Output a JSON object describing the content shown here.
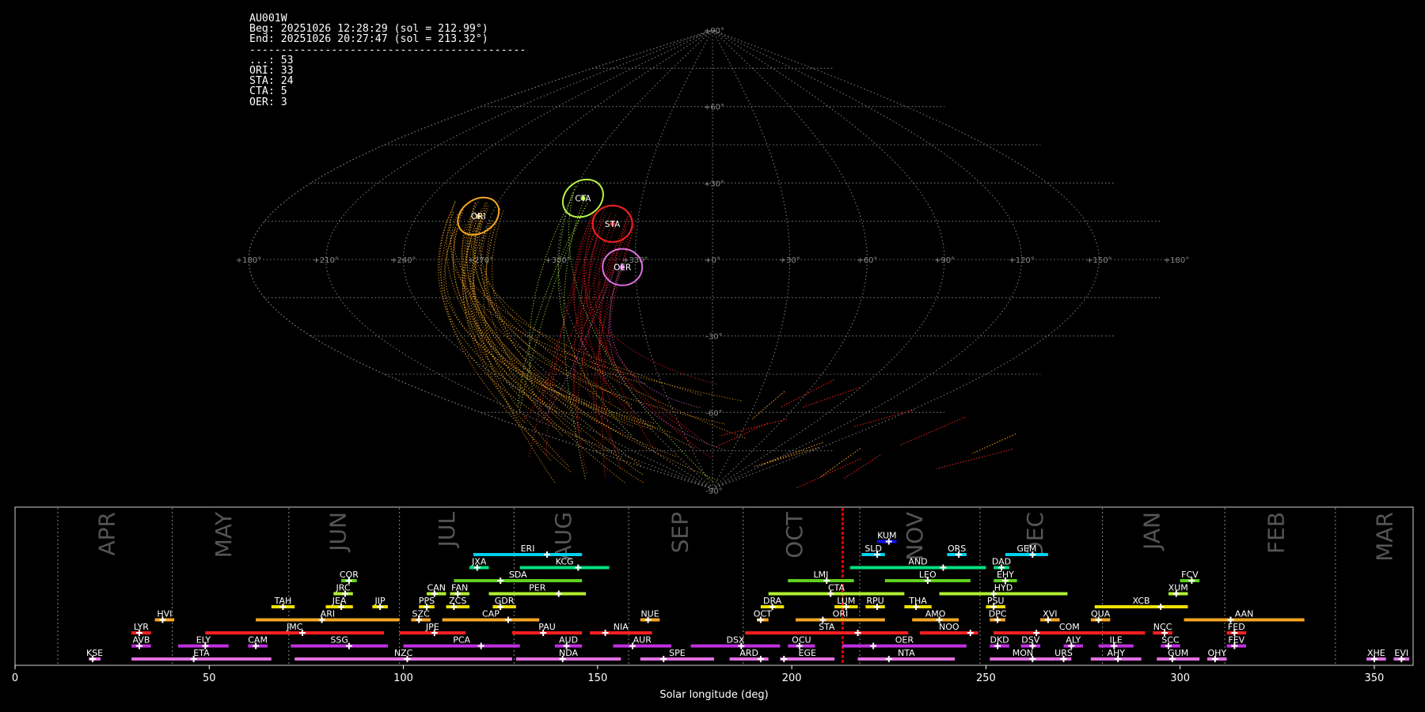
{
  "stats": {
    "station": "AU001W",
    "beg": "Beg: 20251026 12:28:29 (sol = 212.99°)",
    "end": "End: 20251026 20:27:47 (sol = 213.32°)",
    "sep": "--------------------------------------------",
    "counts": [
      "...: 53",
      "ORI: 33",
      "STA: 24",
      "CTA: 5",
      "OER: 3"
    ]
  },
  "colors": {
    "background": "#000000",
    "grid": "#777777",
    "ORI": "#f5a623",
    "STA": "#ff2020",
    "CTA": "#b7f542",
    "OER": "#e070e0",
    "sporadic": "#cc2222",
    "current_sol": "#dd0000"
  },
  "chart_data": [
    {
      "type": "scatter",
      "projection": "sinusoidal",
      "lon_labels": [
        "+180°",
        "+150°",
        "+120°",
        "+90°",
        "+60°",
        "+30°",
        "+0°",
        "+330°",
        "+300°",
        "+270°",
        "+240°",
        "+210°",
        "+180°"
      ],
      "lat_labels": [
        "+90°",
        "+60°",
        "+30°",
        "-30°",
        "-60°",
        "-90°"
      ],
      "radiants": [
        {
          "name": "ORI",
          "lon": 95,
          "lat": 17,
          "color": "#f5a623"
        },
        {
          "name": "CTA",
          "lon": 55,
          "lat": 24,
          "color": "#b7f542"
        },
        {
          "name": "STA",
          "lon": 40,
          "lat": 14,
          "color": "#ff2020"
        },
        {
          "name": "OER",
          "lon": 35,
          "lat": -3,
          "color": "#e070e0"
        }
      ],
      "radiant_counts": {
        "...": 53,
        "ORI": 33,
        "STA": 24,
        "CTA": 5,
        "OER": 3
      }
    },
    {
      "type": "timeline",
      "xlabel": "Solar longitude (deg)",
      "xlim": [
        0,
        360
      ],
      "xticks": [
        0,
        50,
        100,
        150,
        200,
        250,
        300,
        350
      ],
      "current_sol": 213.1,
      "months": [
        {
          "name": "APR",
          "start": 11,
          "label": 24
        },
        {
          "name": "MAY",
          "start": 40.5,
          "label": 54
        },
        {
          "name": "JUN",
          "start": 70.5,
          "label": 83.5
        },
        {
          "name": "JUL",
          "start": 99,
          "label": 111.5
        },
        {
          "name": "AUG",
          "start": 128.5,
          "label": 141.5
        },
        {
          "name": "SEP",
          "start": 158,
          "label": 171.5
        },
        {
          "name": "OCT",
          "start": 187.5,
          "label": 201
        },
        {
          "name": "NOV",
          "start": 217.5,
          "label": 232
        },
        {
          "name": "DEC",
          "start": 248.5,
          "label": 263
        },
        {
          "name": "JAN",
          "start": 280,
          "label": 293
        },
        {
          "name": "FEB",
          "start": 311.5,
          "label": 325
        },
        {
          "name": "MAR",
          "start": 340,
          "label": 353
        }
      ],
      "showers": [
        {
          "code": "KUM",
          "row": 9,
          "start": 222,
          "end": 227,
          "peak": 225,
          "color": "#1010ee"
        },
        {
          "code": "ERI",
          "row": 8,
          "start": 118,
          "end": 146,
          "peak": 137,
          "color": "#00d0f0"
        },
        {
          "code": "SLD",
          "row": 8,
          "start": 218,
          "end": 224,
          "peak": 222,
          "color": "#00d0f0"
        },
        {
          "code": "ORS",
          "row": 8,
          "start": 240,
          "end": 245,
          "peak": 243,
          "color": "#00d0f0"
        },
        {
          "code": "GEM",
          "row": 8,
          "start": 255,
          "end": 266,
          "peak": 262,
          "color": "#00d0f0"
        },
        {
          "code": "JXA",
          "row": 7,
          "start": 117,
          "end": 122,
          "peak": 119,
          "color": "#00e080"
        },
        {
          "code": "KCG",
          "row": 7,
          "start": 130,
          "end": 153,
          "peak": 145,
          "color": "#00e080"
        },
        {
          "code": "AND",
          "row": 7,
          "start": 215,
          "end": 250,
          "peak": 239,
          "color": "#00e080"
        },
        {
          "code": "DAD",
          "row": 7,
          "start": 252,
          "end": 256,
          "peak": 254,
          "color": "#00e080"
        },
        {
          "code": "COR",
          "row": 6,
          "start": 84,
          "end": 88,
          "peak": 86,
          "color": "#60d020"
        },
        {
          "code": "SDA",
          "row": 6,
          "start": 113,
          "end": 146,
          "peak": 125,
          "color": "#60d020"
        },
        {
          "code": "LMI",
          "row": 6,
          "start": 199,
          "end": 216,
          "peak": 209,
          "color": "#60d020"
        },
        {
          "code": "LEO",
          "row": 6,
          "start": 224,
          "end": 246,
          "peak": 235,
          "color": "#60d020"
        },
        {
          "code": "EHY",
          "row": 6,
          "start": 252,
          "end": 258,
          "peak": 255,
          "color": "#60d020"
        },
        {
          "code": "FCV",
          "row": 6,
          "start": 300,
          "end": 305,
          "peak": 303,
          "color": "#60d020"
        },
        {
          "code": "JRC",
          "row": 5,
          "start": 82,
          "end": 87,
          "peak": 85,
          "color": "#b0f030"
        },
        {
          "code": "CAN",
          "row": 5,
          "start": 106,
          "end": 111,
          "peak": 108,
          "color": "#b0f030"
        },
        {
          "code": "FAN",
          "row": 5,
          "start": 112,
          "end": 117,
          "peak": 114,
          "color": "#b0f030"
        },
        {
          "code": "PER",
          "row": 5,
          "start": 122,
          "end": 147,
          "peak": 140,
          "color": "#b0f030"
        },
        {
          "code": "CTA",
          "row": 5,
          "start": 194,
          "end": 229,
          "peak": 210,
          "color": "#b0f030"
        },
        {
          "code": "HYD",
          "row": 5,
          "start": 238,
          "end": 271,
          "peak": 252,
          "color": "#b0f030"
        },
        {
          "code": "XUM",
          "row": 5,
          "start": 297,
          "end": 302,
          "peak": 299,
          "color": "#b0f030"
        },
        {
          "code": "TAH",
          "row": 4,
          "start": 66,
          "end": 72,
          "peak": 69,
          "color": "#f0e000"
        },
        {
          "code": "JEA",
          "row": 4,
          "start": 80,
          "end": 87,
          "peak": 84,
          "color": "#f0e000"
        },
        {
          "code": "JIP",
          "row": 4,
          "start": 92,
          "end": 96,
          "peak": 94,
          "color": "#f0e000"
        },
        {
          "code": "PPS",
          "row": 4,
          "start": 104,
          "end": 108,
          "peak": 106,
          "color": "#f0e000"
        },
        {
          "code": "ZCS",
          "row": 4,
          "start": 111,
          "end": 117,
          "peak": 113,
          "color": "#f0e000"
        },
        {
          "code": "GDR",
          "row": 4,
          "start": 123,
          "end": 129,
          "peak": 125,
          "color": "#f0e000"
        },
        {
          "code": "DRA",
          "row": 4,
          "start": 192,
          "end": 198,
          "peak": 195,
          "color": "#f0e000"
        },
        {
          "code": "LUM",
          "row": 4,
          "start": 211,
          "end": 217,
          "peak": 214,
          "color": "#f0e000"
        },
        {
          "code": "RPU",
          "row": 4,
          "start": 219,
          "end": 224,
          "peak": 222,
          "color": "#f0e000"
        },
        {
          "code": "THA",
          "row": 4,
          "start": 229,
          "end": 236,
          "peak": 232,
          "color": "#f0e000"
        },
        {
          "code": "PSU",
          "row": 4,
          "start": 250,
          "end": 255,
          "peak": 252,
          "color": "#f0e000"
        },
        {
          "code": "XCB",
          "row": 4,
          "start": 278,
          "end": 302,
          "peak": 295,
          "color": "#f0e000"
        },
        {
          "code": "HVI",
          "row": 3,
          "start": 36,
          "end": 41,
          "peak": 38,
          "color": "#f5a623"
        },
        {
          "code": "ARI",
          "row": 3,
          "start": 62,
          "end": 99,
          "peak": 79,
          "color": "#f5a623"
        },
        {
          "code": "SZC",
          "row": 3,
          "start": 102,
          "end": 107,
          "peak": 104,
          "color": "#f5a623"
        },
        {
          "code": "CAP",
          "row": 3,
          "start": 110,
          "end": 135,
          "peak": 127,
          "color": "#f5a623"
        },
        {
          "code": "NUE",
          "row": 3,
          "start": 161,
          "end": 166,
          "peak": 163,
          "color": "#f5a623"
        },
        {
          "code": "OCT",
          "row": 3,
          "start": 191,
          "end": 194,
          "peak": 192,
          "color": "#f5a623"
        },
        {
          "code": "ORI",
          "row": 3,
          "start": 201,
          "end": 224,
          "peak": 208,
          "color": "#f5a623"
        },
        {
          "code": "AMO",
          "row": 3,
          "start": 231,
          "end": 243,
          "peak": 238,
          "color": "#f5a623"
        },
        {
          "code": "DPC",
          "row": 3,
          "start": 251,
          "end": 255,
          "peak": 253,
          "color": "#f5a623"
        },
        {
          "code": "XVI",
          "row": 3,
          "start": 264,
          "end": 269,
          "peak": 266,
          "color": "#f5a623"
        },
        {
          "code": "QUA",
          "row": 3,
          "start": 277,
          "end": 282,
          "peak": 279,
          "color": "#f5a623"
        },
        {
          "code": "AAN",
          "row": 3,
          "start": 301,
          "end": 332,
          "peak": 313,
          "color": "#f5a623"
        },
        {
          "code": "LYR",
          "row": 2,
          "start": 30,
          "end": 35,
          "peak": 32,
          "color": "#ff2020"
        },
        {
          "code": "JMC",
          "row": 2,
          "start": 49,
          "end": 95,
          "peak": 74,
          "color": "#ff2020"
        },
        {
          "code": "JPE",
          "row": 2,
          "start": 99,
          "end": 116,
          "peak": 108,
          "color": "#ff2020"
        },
        {
          "code": "PAU",
          "row": 2,
          "start": 128,
          "end": 146,
          "peak": 136,
          "color": "#ff2020"
        },
        {
          "code": "NIA",
          "row": 2,
          "start": 148,
          "end": 164,
          "peak": 152,
          "color": "#ff2020"
        },
        {
          "code": "STA",
          "row": 2,
          "start": 188,
          "end": 230,
          "peak": 217,
          "color": "#ff2020"
        },
        {
          "code": "NOO",
          "row": 2,
          "start": 233,
          "end": 248,
          "peak": 246,
          "color": "#ff2020"
        },
        {
          "code": "COM",
          "row": 2,
          "start": 252,
          "end": 291,
          "peak": 263,
          "color": "#ff2020"
        },
        {
          "code": "NCC",
          "row": 2,
          "start": 293,
          "end": 298,
          "peak": 296,
          "color": "#ff2020"
        },
        {
          "code": "FED",
          "row": 2,
          "start": 312,
          "end": 317,
          "peak": 314,
          "color": "#ff2020"
        },
        {
          "code": "AVB",
          "row": 1,
          "start": 30,
          "end": 35,
          "peak": 32,
          "color": "#c030e0"
        },
        {
          "code": "ELY",
          "row": 1,
          "start": 42,
          "end": 55,
          "peak": 49,
          "color": "#c030e0"
        },
        {
          "code": "CAM",
          "row": 1,
          "start": 60,
          "end": 65,
          "peak": 62,
          "color": "#c030e0"
        },
        {
          "code": "SSG",
          "row": 1,
          "start": 71,
          "end": 96,
          "peak": 86,
          "color": "#c030e0"
        },
        {
          "code": "PCA",
          "row": 1,
          "start": 100,
          "end": 130,
          "peak": 120,
          "color": "#c030e0"
        },
        {
          "code": "AUD",
          "row": 1,
          "start": 139,
          "end": 146,
          "peak": 142,
          "color": "#c030e0"
        },
        {
          "code": "AUR",
          "row": 1,
          "start": 154,
          "end": 169,
          "peak": 159,
          "color": "#c030e0"
        },
        {
          "code": "DSX",
          "row": 1,
          "start": 174,
          "end": 197,
          "peak": 187,
          "color": "#c030e0"
        },
        {
          "code": "OCU",
          "row": 1,
          "start": 199,
          "end": 206,
          "peak": 202,
          "color": "#c030e0"
        },
        {
          "code": "OER",
          "row": 1,
          "start": 213,
          "end": 245,
          "peak": 221,
          "color": "#c030e0"
        },
        {
          "code": "DKD",
          "row": 1,
          "start": 251,
          "end": 256,
          "peak": 253,
          "color": "#c030e0"
        },
        {
          "code": "DSV",
          "row": 1,
          "start": 259,
          "end": 264,
          "peak": 262,
          "color": "#c030e0"
        },
        {
          "code": "ALY",
          "row": 1,
          "start": 270,
          "end": 275,
          "peak": 272,
          "color": "#c030e0"
        },
        {
          "code": "ILE",
          "row": 1,
          "start": 279,
          "end": 288,
          "peak": 283,
          "color": "#c030e0"
        },
        {
          "code": "SCC",
          "row": 1,
          "start": 295,
          "end": 300,
          "peak": 297,
          "color": "#c030e0"
        },
        {
          "code": "FEV",
          "row": 1,
          "start": 312,
          "end": 317,
          "peak": 314,
          "color": "#c030e0"
        },
        {
          "code": "KSE",
          "row": 0,
          "start": 19,
          "end": 22,
          "peak": 20,
          "color": "#e070e0"
        },
        {
          "code": "ETA",
          "row": 0,
          "start": 30,
          "end": 66,
          "peak": 46,
          "color": "#e070e0"
        },
        {
          "code": "NZC",
          "row": 0,
          "start": 72,
          "end": 128,
          "peak": 101,
          "color": "#e070e0"
        },
        {
          "code": "NDA",
          "row": 0,
          "start": 129,
          "end": 156,
          "peak": 141,
          "color": "#e070e0"
        },
        {
          "code": "SPE",
          "row": 0,
          "start": 161,
          "end": 180,
          "peak": 167,
          "color": "#e070e0"
        },
        {
          "code": "ARD",
          "row": 0,
          "start": 184,
          "end": 194,
          "peak": 192,
          "color": "#e070e0"
        },
        {
          "code": "EGE",
          "row": 0,
          "start": 197,
          "end": 211,
          "peak": 198,
          "color": "#e070e0"
        },
        {
          "code": "NTA",
          "row": 0,
          "start": 217,
          "end": 242,
          "peak": 225,
          "color": "#e070e0"
        },
        {
          "code": "MON",
          "row": 0,
          "start": 251,
          "end": 268,
          "peak": 262,
          "color": "#e070e0"
        },
        {
          "code": "URS",
          "row": 0,
          "start": 268,
          "end": 272,
          "peak": 270,
          "color": "#e070e0"
        },
        {
          "code": "AHY",
          "row": 0,
          "start": 277,
          "end": 290,
          "peak": 284,
          "color": "#e070e0"
        },
        {
          "code": "GUM",
          "row": 0,
          "start": 294,
          "end": 305,
          "peak": 298,
          "color": "#e070e0"
        },
        {
          "code": "OHY",
          "row": 0,
          "start": 307,
          "end": 312,
          "peak": 309,
          "color": "#e070e0"
        },
        {
          "code": "XHE",
          "row": 0,
          "start": 348,
          "end": 353,
          "peak": 350,
          "color": "#e070e0"
        },
        {
          "code": "EVI",
          "row": 0,
          "start": 355,
          "end": 359,
          "peak": 357,
          "color": "#e070e0"
        }
      ]
    }
  ]
}
